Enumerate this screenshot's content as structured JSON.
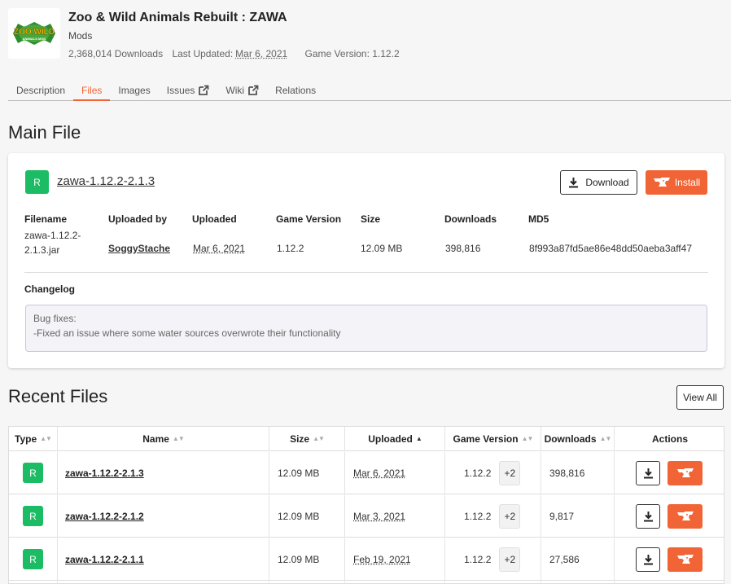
{
  "project": {
    "logo_text": "ZOO WILD ANIMALS MOD",
    "title": "Zoo & Wild Animals Rebuilt : ZAWA",
    "category": "Mods",
    "downloads": "2,368,014 Downloads",
    "last_updated_label": "Last Updated:",
    "last_updated": "Mar 6, 2021",
    "game_version": "Game Version: 1.12.2"
  },
  "tabs": [
    {
      "label": "Description"
    },
    {
      "label": "Files"
    },
    {
      "label": "Images"
    },
    {
      "label": "Issues"
    },
    {
      "label": "Wiki"
    },
    {
      "label": "Relations"
    }
  ],
  "main_file": {
    "heading": "Main File",
    "release_badge": "R",
    "name": "zawa-1.12.2-2.1.3",
    "download_label": "Download",
    "install_label": "Install",
    "headers": {
      "filename": "Filename",
      "uploaded_by": "Uploaded by",
      "uploaded": "Uploaded",
      "game_version": "Game Version",
      "size": "Size",
      "downloads": "Downloads",
      "md5": "MD5"
    },
    "values": {
      "filename_line1": "zawa-1.12.2-",
      "filename_line2": "2.1.3.jar",
      "uploaded_by": "SoggyStache",
      "uploaded": "Mar 6, 2021",
      "game_version": "1.12.2",
      "size": "12.09 MB",
      "downloads": "398,816",
      "md5": "8f993a87fd5ae86e48dd50aeba3aff47"
    },
    "changelog_heading": "Changelog",
    "changelog_line1": "Bug fixes:",
    "changelog_line2": "-Fixed an issue where some water sources overwrote their functionality"
  },
  "recent_files": {
    "heading": "Recent Files",
    "view_all": "View All",
    "columns": {
      "type": "Type",
      "name": "Name",
      "size": "Size",
      "uploaded": "Uploaded",
      "game_version": "Game Version",
      "downloads": "Downloads",
      "actions": "Actions"
    },
    "rows": [
      {
        "type": "R",
        "name": "zawa-1.12.2-2.1.3",
        "size": "12.09 MB",
        "uploaded": "Mar 6, 2021",
        "game_version": "1.12.2",
        "extra_versions": "+2",
        "downloads": "398,816"
      },
      {
        "type": "R",
        "name": "zawa-1.12.2-2.1.2",
        "size": "12.09 MB",
        "uploaded": "Mar 3, 2021",
        "game_version": "1.12.2",
        "extra_versions": "+2",
        "downloads": "9,817"
      },
      {
        "type": "R",
        "name": "zawa-1.12.2-2.1.1",
        "size": "12.09 MB",
        "uploaded": "Feb 19, 2021",
        "game_version": "1.12.2",
        "extra_versions": "+2",
        "downloads": "27,586"
      }
    ]
  },
  "colors": {
    "accent": "#f16436",
    "release_green": "#1bbc64"
  }
}
